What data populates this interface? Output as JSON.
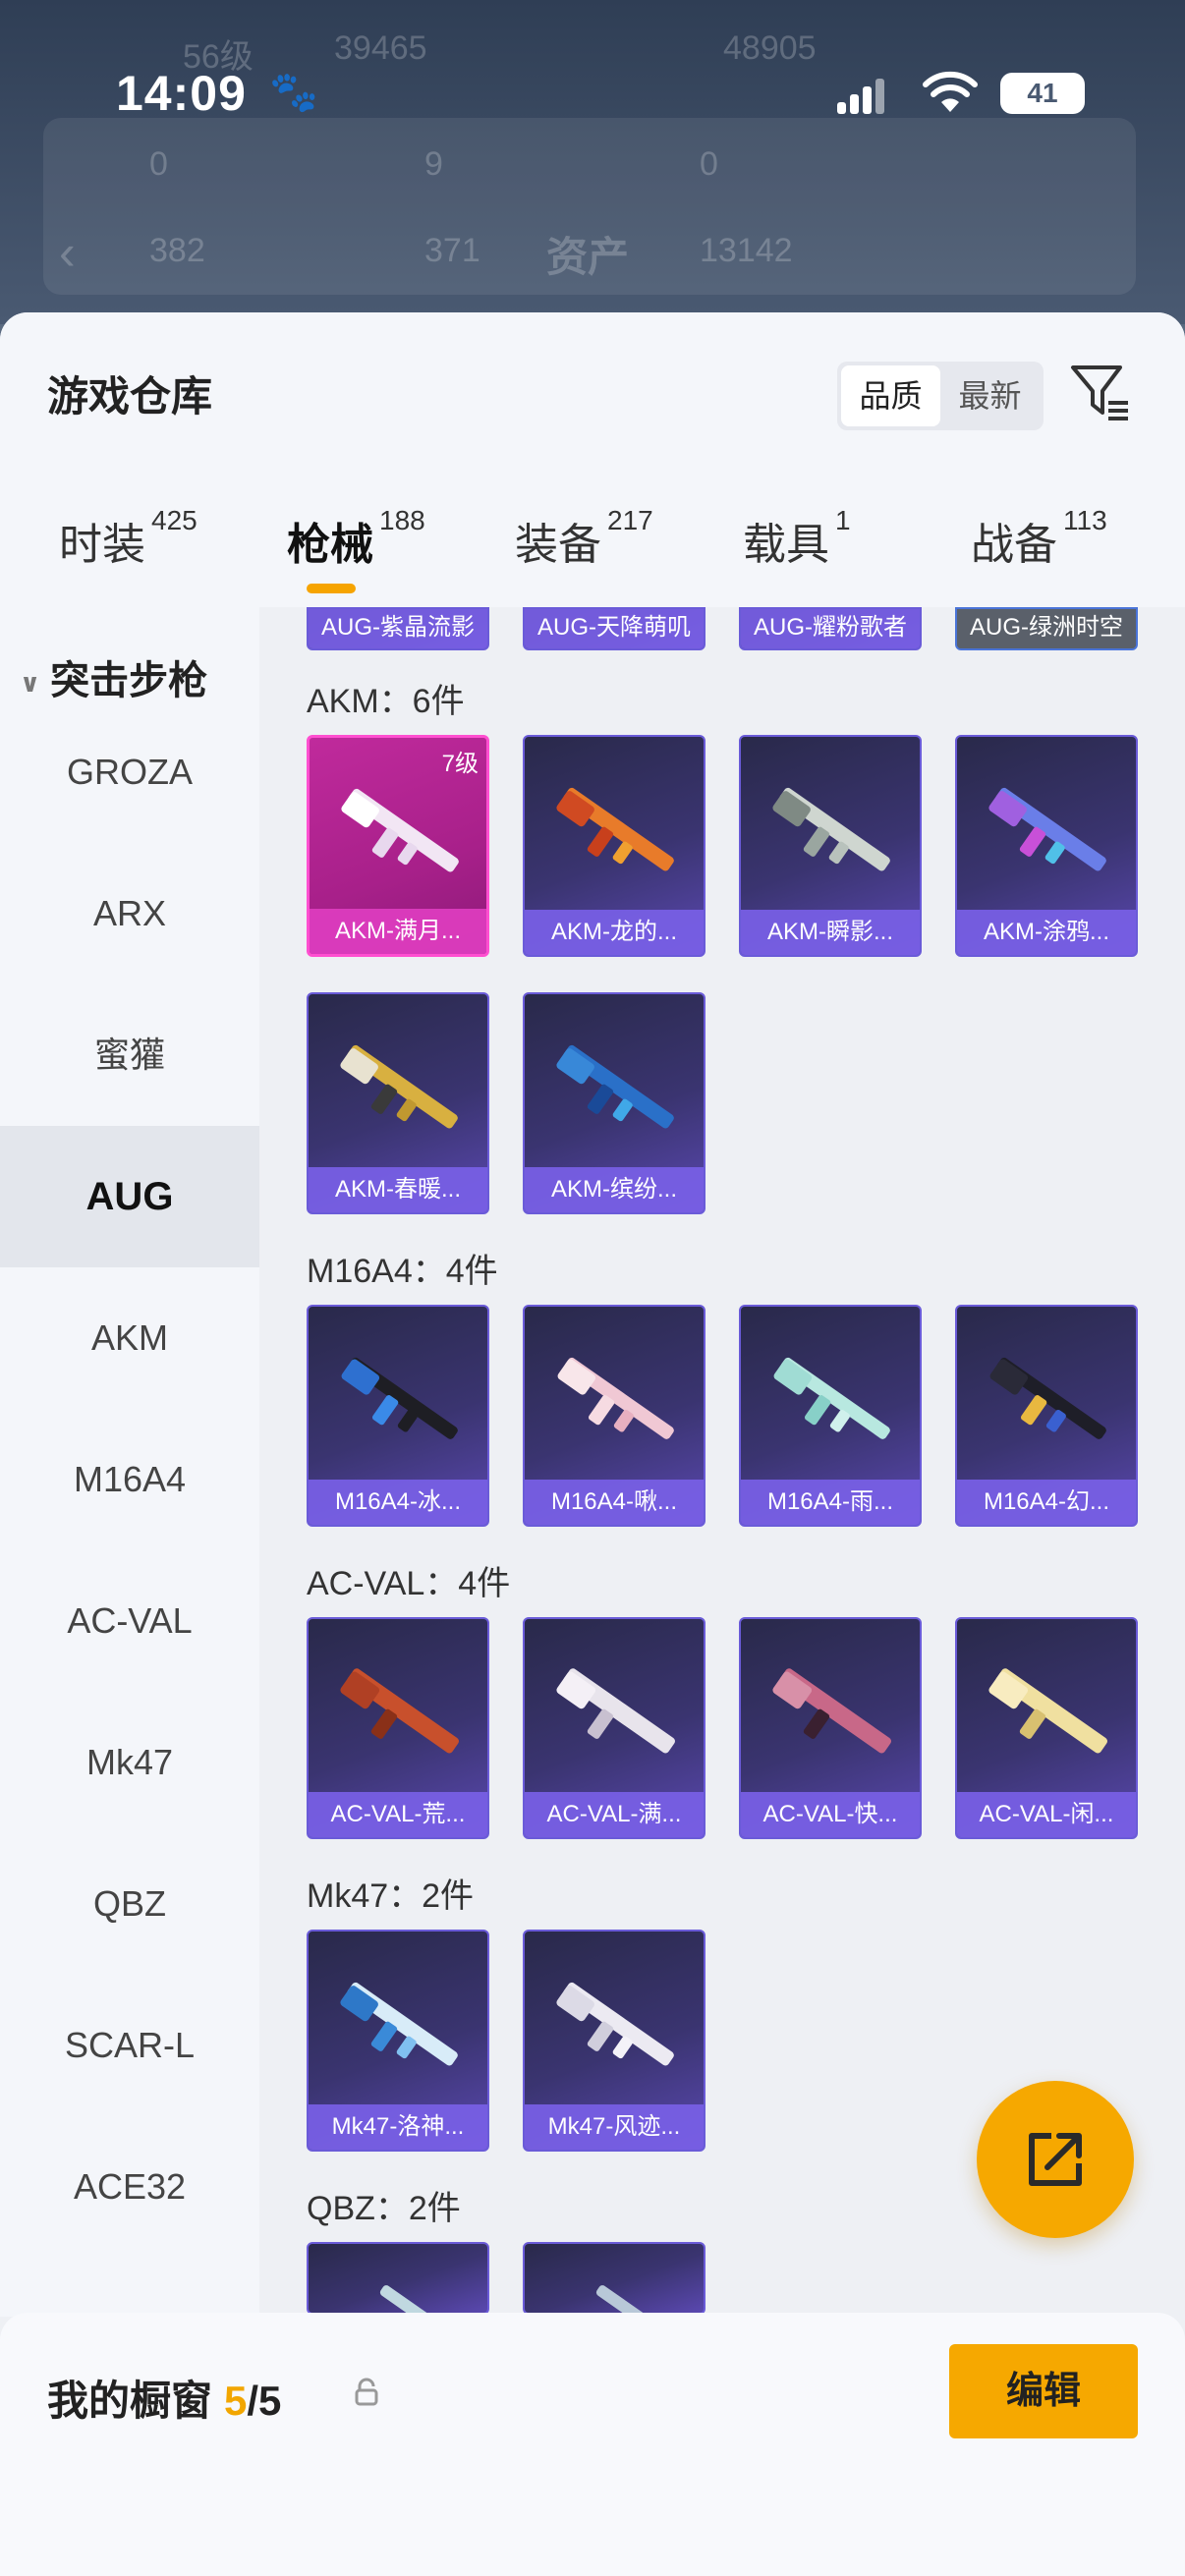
{
  "background": {
    "ghost_texts": [
      "56级",
      "39465",
      "48905",
      "0",
      "9",
      "0",
      "382",
      "371",
      "资产",
      "13142"
    ]
  },
  "statusbar": {
    "time": "14:09",
    "battery": "41"
  },
  "sheet": {
    "title": "游戏仓库",
    "sort_options": [
      "品质",
      "最新"
    ],
    "tabs": [
      {
        "label": "时装",
        "count": "425"
      },
      {
        "label": "枪械",
        "count": "188"
      },
      {
        "label": "装备",
        "count": "217"
      },
      {
        "label": "载具",
        "count": "1"
      },
      {
        "label": "战备",
        "count": "113"
      }
    ]
  },
  "sidebar": {
    "group": "突击步枪",
    "items": [
      "GROZA",
      "ARX",
      "蜜獾",
      "AUG",
      "AKM",
      "M16A4",
      "AC-VAL",
      "Mk47",
      "QBZ",
      "SCAR-L",
      "ACE32"
    ]
  },
  "content": {
    "aug_partial": [
      "AUG-紫晶流影",
      "AUG-天降萌叽",
      "AUG-耀粉歌者",
      "AUG-绿洲时空"
    ],
    "sections": [
      {
        "title": "AKM：6件",
        "items": [
          "AKM-满月...",
          "AKM-龙的...",
          "AKM-瞬影...",
          "AKM-涂鸦...",
          "AKM-春暖...",
          "AKM-缤纷..."
        ],
        "badge": "7级"
      },
      {
        "title": "M16A4：4件",
        "items": [
          "M16A4-冰...",
          "M16A4-啾...",
          "M16A4-雨...",
          "M16A4-幻..."
        ]
      },
      {
        "title": "AC-VAL：4件",
        "items": [
          "AC-VAL-荒...",
          "AC-VAL-满...",
          "AC-VAL-快...",
          "AC-VAL-闲..."
        ]
      },
      {
        "title": "Mk47：2件",
        "items": [
          "Mk47-洛神...",
          "Mk47-风迹..."
        ]
      },
      {
        "title": "QBZ：2件",
        "items": [
          "",
          ""
        ]
      }
    ]
  },
  "bottom": {
    "label": "我的橱窗",
    "count_used": "5",
    "count_sep": "/",
    "count_total": "5",
    "edit_label": "编辑"
  },
  "colors": {
    "accent": "#f6a800",
    "tile_purple": "#3a3470",
    "tile_pink": "#c02a9c"
  }
}
